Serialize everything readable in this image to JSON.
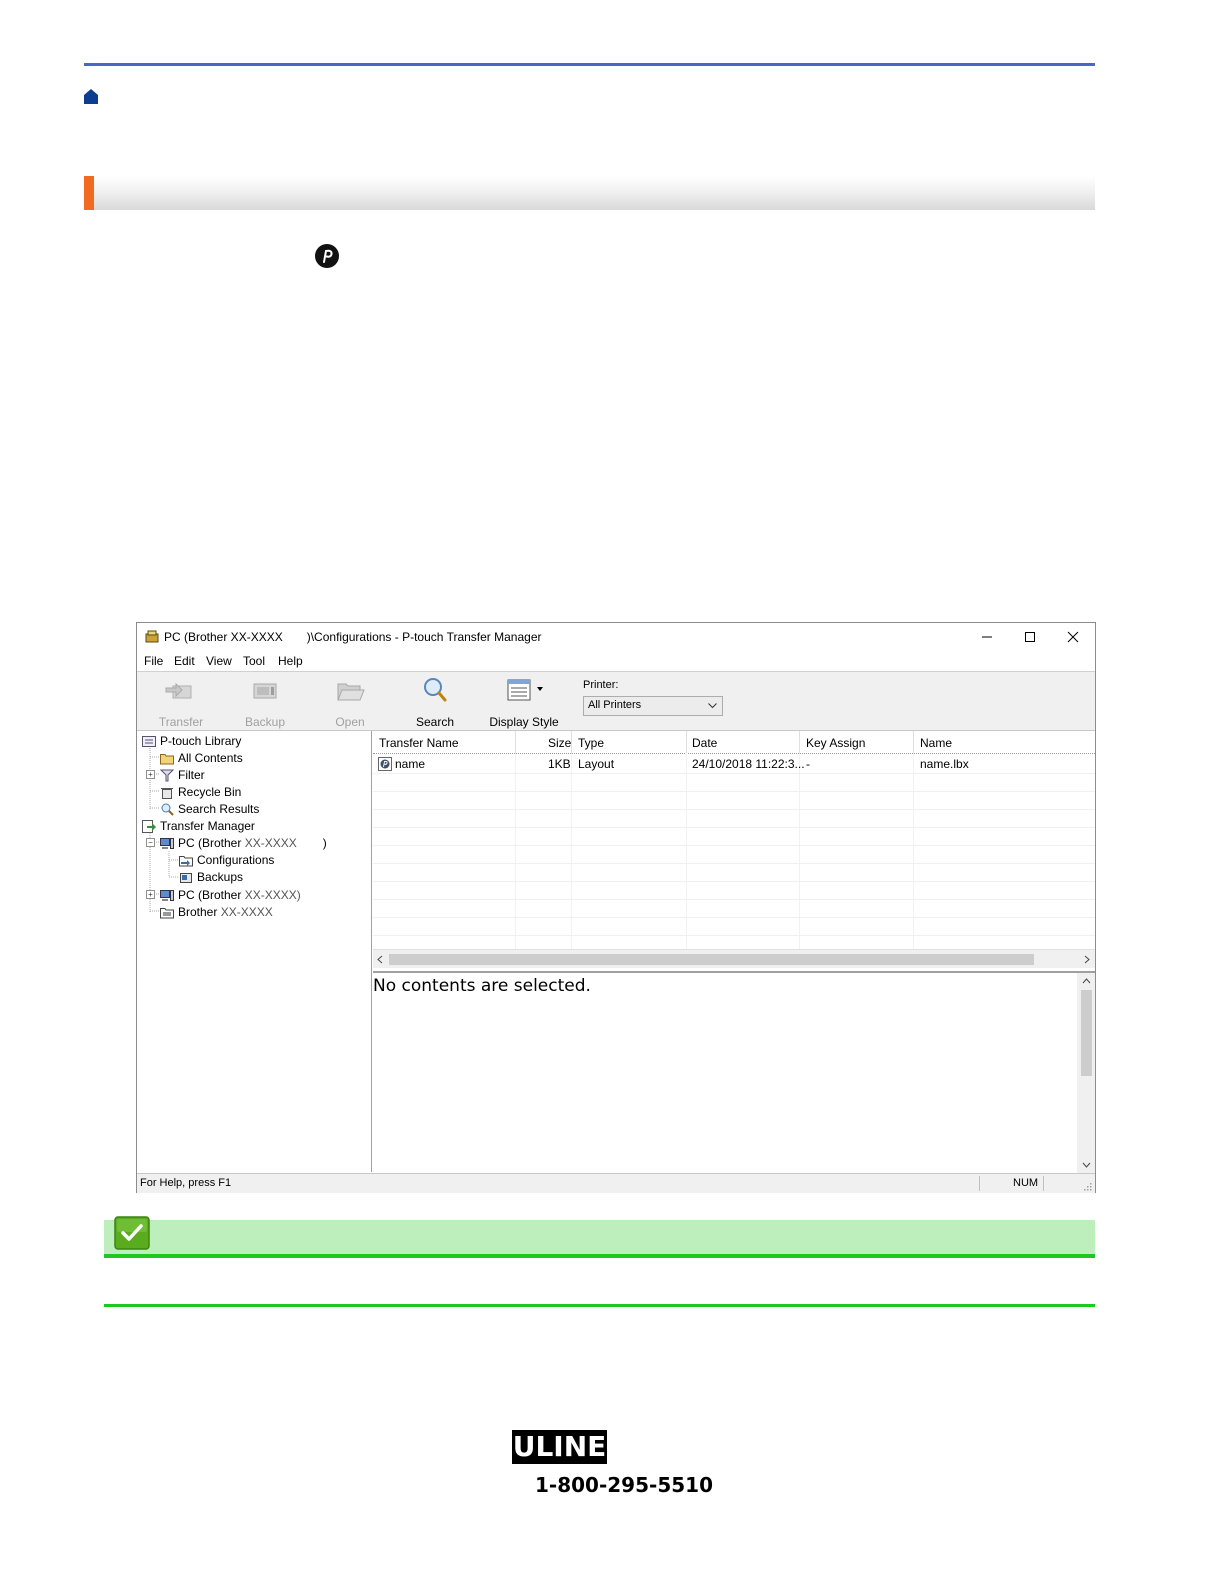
{
  "colors": {
    "top_rule": "#4a66c8",
    "section_accent": "#f26a21",
    "note_fill": "#bcefbc",
    "note_rule": "#1ec81e"
  },
  "icons": {
    "home": "home-icon",
    "ptouch": "ptouch-editor-icon",
    "note": "checkmark-icon"
  },
  "app": {
    "title_prefix": "PC (Brother XX-XXXX",
    "title_suffix": ")\\Configurations - P-touch Transfer Manager",
    "menu": [
      "File",
      "Edit",
      "View",
      "Tool",
      "Help"
    ],
    "toolbar": {
      "transfer": "Transfer",
      "backup": "Backup",
      "open": "Open",
      "search": "Search",
      "display_style": "Display Style",
      "printer_label": "Printer:",
      "printer_value": "All Printers"
    },
    "tree": {
      "library": "P-touch Library",
      "all_contents": "All Contents",
      "filter": "Filter",
      "recycle_bin": "Recycle Bin",
      "search_results": "Search Results",
      "transfer_manager": "Transfer Manager",
      "pc1_prefix": "PC (Brother",
      "pc1_model": "XX-XXXX",
      "pc1_suffix": ")",
      "configurations": "Configurations",
      "backups": "Backups",
      "pc2_prefix": "PC (Brother",
      "pc2_model": "XX-XXXX)",
      "brother_prefix": "Brother",
      "brother_model": "XX-XXXX"
    },
    "columns": [
      "Transfer Name",
      "Size",
      "Type",
      "Date",
      "Key Assign",
      "Name"
    ],
    "rows": [
      {
        "transfer_name": "name",
        "size": "1KB",
        "type": "Layout",
        "date": "24/10/2018 11:22:3...",
        "key_assign": "-",
        "name": "name.lbx"
      }
    ],
    "preview_text": "No contents are selected.",
    "status_help": "For Help, press F1",
    "status_num": "NUM"
  },
  "footer": {
    "logo": "ULINE",
    "phone": "1-800-295-5510"
  }
}
